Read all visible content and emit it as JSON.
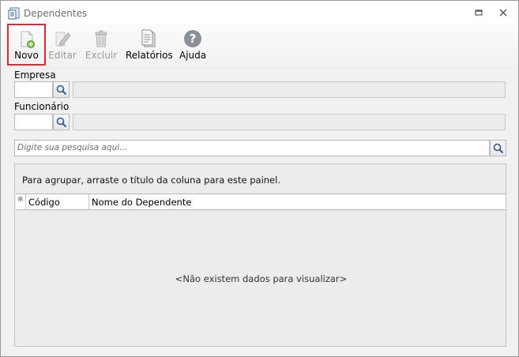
{
  "window": {
    "title": "Dependentes"
  },
  "toolbar": {
    "items": [
      {
        "label": "Novo",
        "icon": "new-document-icon",
        "enabled": true,
        "highlighted": true
      },
      {
        "label": "Editar",
        "icon": "edit-pencil-icon",
        "enabled": false
      },
      {
        "label": "Excluir",
        "icon": "trash-icon",
        "enabled": false
      },
      {
        "label": "Relatórios",
        "icon": "report-icon",
        "enabled": true
      },
      {
        "label": "Ajuda",
        "icon": "help-icon",
        "enabled": true
      }
    ]
  },
  "filters": {
    "empresa_label": "Empresa",
    "empresa_code": "",
    "empresa_desc": "",
    "funcionario_label": "Funcionário",
    "funcionario_code": "",
    "funcionario_desc": ""
  },
  "search": {
    "placeholder": "Digite sua pesquisa aqui..."
  },
  "grid": {
    "group_panel_text": "Para agrupar, arraste o título da coluna para este painel.",
    "columns": [
      "Código",
      "Nome do Dependente"
    ],
    "empty_text": "<Não existem dados para visualizar>"
  },
  "colors": {
    "highlight_border": "#e0262e",
    "help_icon": "#8a9097"
  }
}
